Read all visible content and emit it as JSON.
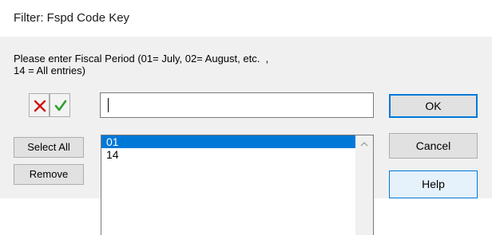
{
  "window": {
    "title": "Filter: Fspd Code Key"
  },
  "prompt": "Please enter Fiscal Period (01= July, 02= August, etc.  ,\n14 = All entries)",
  "input": {
    "value": ""
  },
  "buttons": {
    "ok": "OK",
    "cancel": "Cancel",
    "help": "Help",
    "select_all": "Select All",
    "remove": "Remove"
  },
  "icons": {
    "cancel_icon": "x-icon",
    "accept_icon": "check-icon",
    "cancel_color": "#d01010",
    "accept_color": "#2e9e2e"
  },
  "list": {
    "items": [
      {
        "label": "01",
        "selected": true
      },
      {
        "label": "14",
        "selected": false
      }
    ]
  }
}
